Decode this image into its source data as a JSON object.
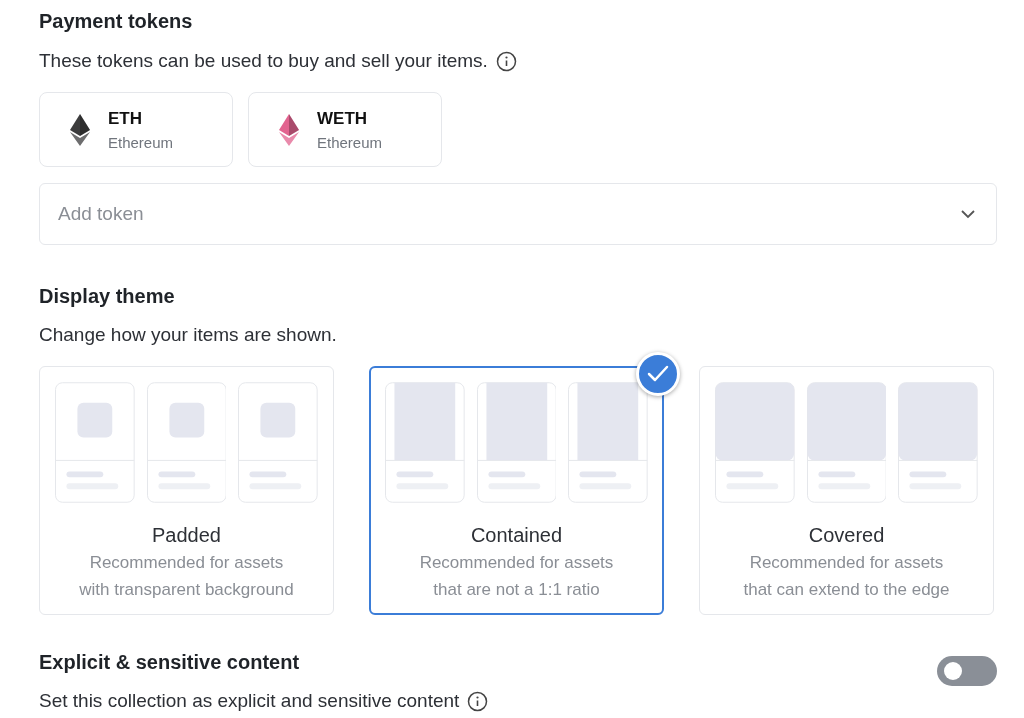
{
  "payment_tokens": {
    "title": "Payment tokens",
    "description": "These tokens can be used to buy and sell your items.",
    "tokens": [
      {
        "symbol": "ETH",
        "network": "Ethereum",
        "color": "#3c3c3d"
      },
      {
        "symbol": "WETH",
        "network": "Ethereum",
        "color": "#e2638f"
      }
    ],
    "add_token": {
      "placeholder": "Add token"
    }
  },
  "display_theme": {
    "title": "Display theme",
    "description": "Change how your items are shown.",
    "options": [
      {
        "kind": "padded",
        "name": "Padded",
        "description": "Recommended for assets with transparent background",
        "selected": false
      },
      {
        "kind": "contained",
        "name": "Contained",
        "description": "Recommended for assets that are not a 1:1 ratio",
        "selected": true
      },
      {
        "kind": "covered",
        "name": "Covered",
        "description": "Recommended for assets that can extend to the edge",
        "selected": false
      }
    ]
  },
  "explicit_content": {
    "title": "Explicit & sensitive content",
    "description": "Set this collection as explicit and sensitive content",
    "on": false
  }
}
